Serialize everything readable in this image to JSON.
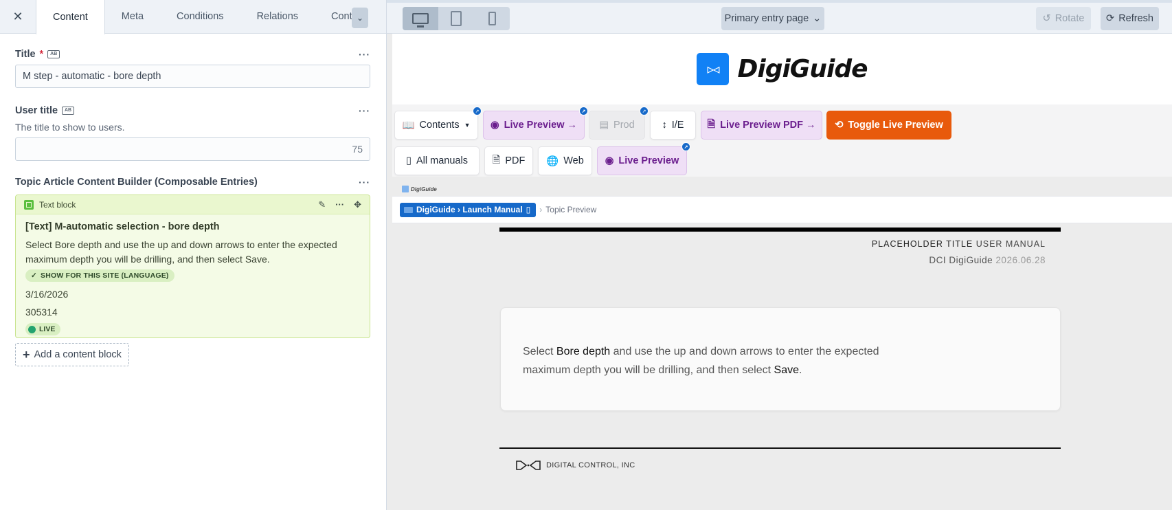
{
  "left": {
    "tabs": [
      {
        "label": "Content"
      },
      {
        "label": "Meta"
      },
      {
        "label": "Conditions"
      },
      {
        "label": "Relations"
      },
      {
        "label": "Content"
      }
    ],
    "title_field": {
      "label": "Title",
      "required_mark": "*",
      "translate_icon": "AB",
      "value": "M step - automatic - bore depth"
    },
    "user_title_field": {
      "label": "User title",
      "translate_icon": "AB",
      "description": "The title to show to users.",
      "value": "",
      "char_count": "75"
    },
    "builder": {
      "label": "Topic Article Content Builder (Composable Entries)",
      "block": {
        "type": "Text block",
        "title": "[Text] M-automatic selection - bore depth",
        "text": "Select Bore depth and use the up and down arrows to enter the expected maximum depth you will be drilling, and then select Save.",
        "site_badge": "SHOW FOR THIS SITE (LANGUAGE)",
        "date": "3/16/2026",
        "id": "305314",
        "status": "LIVE"
      },
      "add_label": "Add a content block"
    },
    "colors": {
      "accent_green": "#c8e48f",
      "required": "#d4283b"
    }
  },
  "right": {
    "page_select": "Primary entry page",
    "rotate_label": "Rotate",
    "refresh_label": "Refresh",
    "logo_mark": "▷◁",
    "logo_text": "DigiGuide",
    "toolbar": {
      "contents": "Contents",
      "live_preview_arrow": "Live Preview →",
      "prod": "Prod",
      "ie": "I/E",
      "live_preview_pdf": "Live Preview PDF →",
      "toggle_live_preview": "Toggle Live Preview",
      "all_manuals": "All manuals",
      "pdf": "PDF",
      "web": "Web",
      "live_preview": "Live Preview"
    },
    "mini_logo": "DigiGuide",
    "breadcrumb": {
      "chip": "DigiGuide › Launch Manual",
      "sep": "›",
      "current": "Topic Preview"
    },
    "doc": {
      "title_a": "PLACEHOLDER TITLE",
      "title_b": "USER MANUAL",
      "sub_a": "DCI DigiGuide",
      "sub_date": "2026.06.28",
      "body_1": "Select ",
      "body_b1": "Bore depth",
      "body_2": " and use the up and down arrows to enter the expected maximum depth you will be drilling, and then select ",
      "body_b2": "Save",
      "body_3": ".",
      "footer": "DIGITAL CONTROL, INC"
    },
    "colors": {
      "orange": "#e85a0c",
      "purple": "#6b1e8e",
      "blue": "#1181f5",
      "crumb_blue": "#1669c9"
    }
  }
}
